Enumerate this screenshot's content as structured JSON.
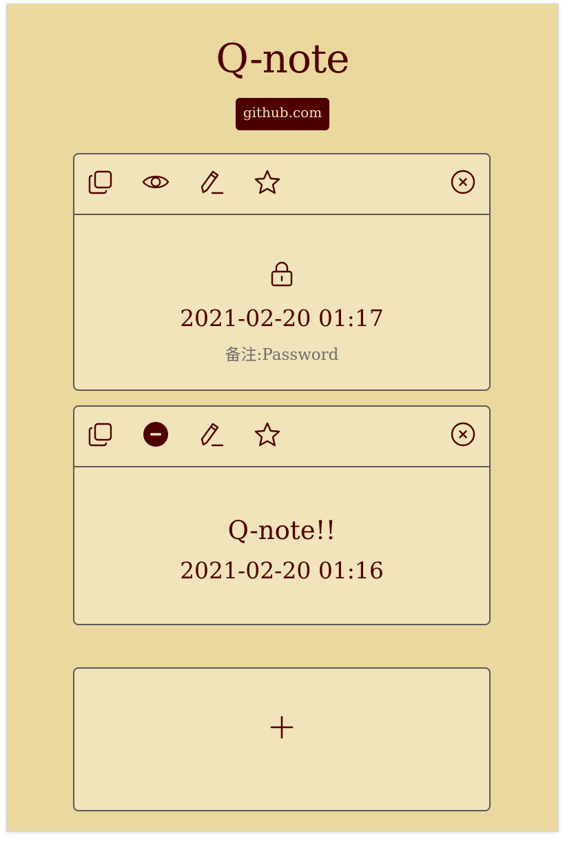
{
  "app": {
    "title": "Q-note",
    "github_label": "github.com"
  },
  "colors": {
    "page_bg": "#ead89e",
    "card_bg": "#f1e3ba",
    "accent": "#4e0000",
    "border": "#5a5a5a",
    "muted_text": "#6d6d6d"
  },
  "notes": [
    {
      "toolbar_icons": [
        "copy-icon",
        "eye-icon",
        "pencil-icon",
        "star-icon",
        "close-circle-icon"
      ],
      "locked": true,
      "time": "2021-02-20 01:17",
      "remark": "备注:Password"
    },
    {
      "toolbar_icons": [
        "copy-icon",
        "minus-circle-icon",
        "pencil-icon",
        "star-icon",
        "close-circle-icon"
      ],
      "locked": false,
      "text": "Q-note!!",
      "time": "2021-02-20 01:16"
    }
  ],
  "add_card": {
    "icon": "plus-icon"
  }
}
